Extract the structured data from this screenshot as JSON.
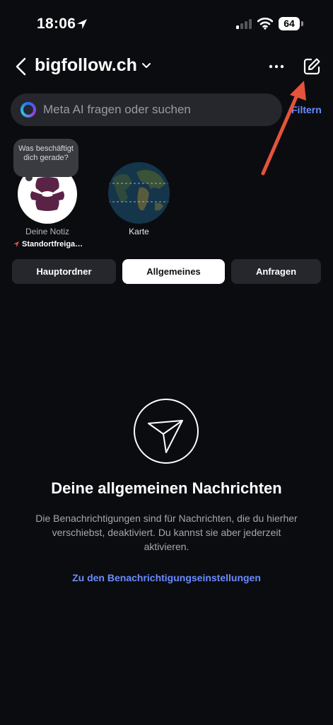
{
  "status_bar": {
    "time": "18:06",
    "battery": "64"
  },
  "header": {
    "title": "bigfollow.ch"
  },
  "search": {
    "placeholder": "Meta AI fragen oder suchen",
    "filter_label": "Filtern"
  },
  "notes": {
    "bubble_text": "Was beschäftigt dich gerade?",
    "my_note_label": "Deine Notiz",
    "location_label": "Standortfreiga…",
    "map_label": "Karte"
  },
  "tabs": [
    {
      "label": "Hauptordner",
      "active": false
    },
    {
      "label": "Allgemeines",
      "active": true
    },
    {
      "label": "Anfragen",
      "active": false
    }
  ],
  "empty_state": {
    "title": "Deine allgemeinen Nachrichten",
    "text": "Die Benachrichtigungen sind für Nachrichten, die du hierher verschiebst, deaktiviert. Du kannst sie aber jederzeit aktivieren.",
    "link": "Zu den Benachrichtigungseinstellungen"
  },
  "colors": {
    "background": "#0b0c10",
    "accent_link": "#6a8cff",
    "annotation_arrow": "#e5533d",
    "logo_purple": "#5a2346"
  },
  "icons": [
    "location-arrow-icon",
    "signal-icon",
    "wifi-icon",
    "battery-icon",
    "back-chevron-icon",
    "chevron-down-icon",
    "more-icon",
    "compose-icon",
    "meta-ai-icon",
    "paper-plane-icon",
    "map-pin-icon"
  ]
}
